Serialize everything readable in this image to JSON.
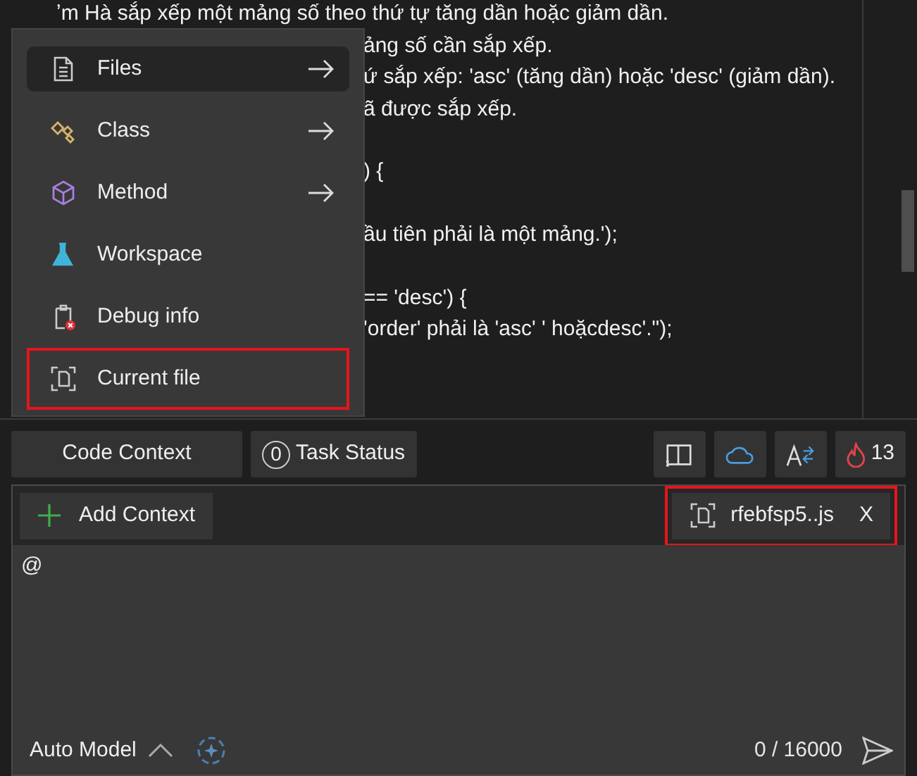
{
  "editor": {
    "code_blocks": [
      [
        "ʼm Hà sắp xếp một mảng số theo thứ tự tăng dần hoặc giảm dần.",
        "ảng số cần sắp xếp.",
        "ứ sắp xếp: 'asc' (tăng dần) hoặc 'desc' (giảm dần).",
        "ã được sắp xếp."
      ],
      [
        ")    {"
      ],
      [
        "ầu tiên phải là một mảng.');"
      ],
      [
        "== 'desc') {",
        "'order' phải là 'asc' ' hoặcdesc'.\");"
      ]
    ]
  },
  "context_menu": {
    "items": [
      {
        "label": "Files",
        "kind": "files",
        "submenu": true,
        "selected": true,
        "highlighted": false
      },
      {
        "label": "Class",
        "kind": "class",
        "submenu": true,
        "selected": false,
        "highlighted": false
      },
      {
        "label": "Method",
        "kind": "method",
        "submenu": true,
        "selected": false,
        "highlighted": false
      },
      {
        "label": "Workspace",
        "kind": "workspace",
        "submenu": false,
        "selected": false,
        "highlighted": false
      },
      {
        "label": "Debug info",
        "kind": "debug",
        "submenu": false,
        "selected": false,
        "highlighted": false
      },
      {
        "label": "Current file",
        "kind": "current",
        "submenu": false,
        "selected": false,
        "highlighted": true
      }
    ]
  },
  "toolbar": {
    "code_context": "Code Context",
    "task_count": "0",
    "task_status": "Task Status",
    "flame_count": "13"
  },
  "chat": {
    "add_context": "Add Context",
    "attachment": {
      "name": "rfebfsp5..js",
      "close": "X",
      "highlighted": true
    },
    "input": "@",
    "model": "Auto Model",
    "counter": "0 / 16000"
  }
}
